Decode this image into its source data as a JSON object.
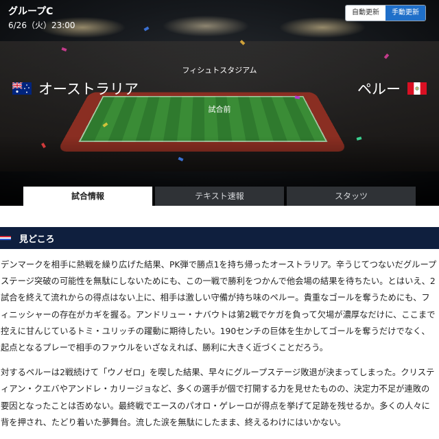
{
  "header": {
    "group": "グループC",
    "date": "6/26（火）23:00",
    "auto_update": "自動更新",
    "manual_update": "手動更新"
  },
  "match": {
    "venue": "フィシュトスタジアム",
    "status": "試合前",
    "home": {
      "name": "オーストラリア",
      "flag_icon": "australia-flag"
    },
    "away": {
      "name": "ペルー",
      "flag_icon": "peru-flag"
    }
  },
  "tabs": [
    {
      "label": "試合情報",
      "active": true
    },
    {
      "label": "テキスト速報",
      "active": false
    },
    {
      "label": "スタッツ",
      "active": false
    }
  ],
  "section": {
    "title": "見どころ",
    "paragraphs": [
      "デンマークを相手に熱戦を繰り広げた結果、PK弾で勝点1を持ち帰ったオーストラリア。辛うじてつないだグループステージ突破の可能性を無駄にしないためにも、この一戦で勝利をつかんで他会場の結果を待ちたい。とはいえ、2試合を終えて流れからの得点はない上に、相手は激しい守備が持ち味のペルー。貴重なゴールを奪うためにも、フィニッシャーの存在がカギを握る。アンドリュー・ナバウトは第2戦でケガを負って欠場が濃厚なだけに、ここまで控えに甘んじているトミ・ユリッチの躍動に期待したい。190センチの巨体を生かしてゴールを奪うだけでなく、起点となるプレーで相手のファウルをいざなえれば、勝利に大きく近づくことだろう。",
      "対するペルーは2戦続けて「ウノゼロ」を喫した結果、早々にグループステージ敗退が決まってしまった。クリスティアン・クエバやアンドレ・カリージョなど、多くの選手が個で打開する力を見せたものの、決定力不足が連敗の要因となったことは否めない。最終戦でエースのパオロ・ゲレーロが得点を挙げて足跡を残せるか。多くの人々に背を押され、たどり着いた夢舞台。流した涙を無駄にしたまま、終えるわけにはいかない。"
    ]
  },
  "colors": {
    "accent_blue": "#1f6fc9",
    "section_bg": "#0f1f3e",
    "mark_red": "#d62a3a",
    "mark_blue": "#2a5bd6"
  }
}
